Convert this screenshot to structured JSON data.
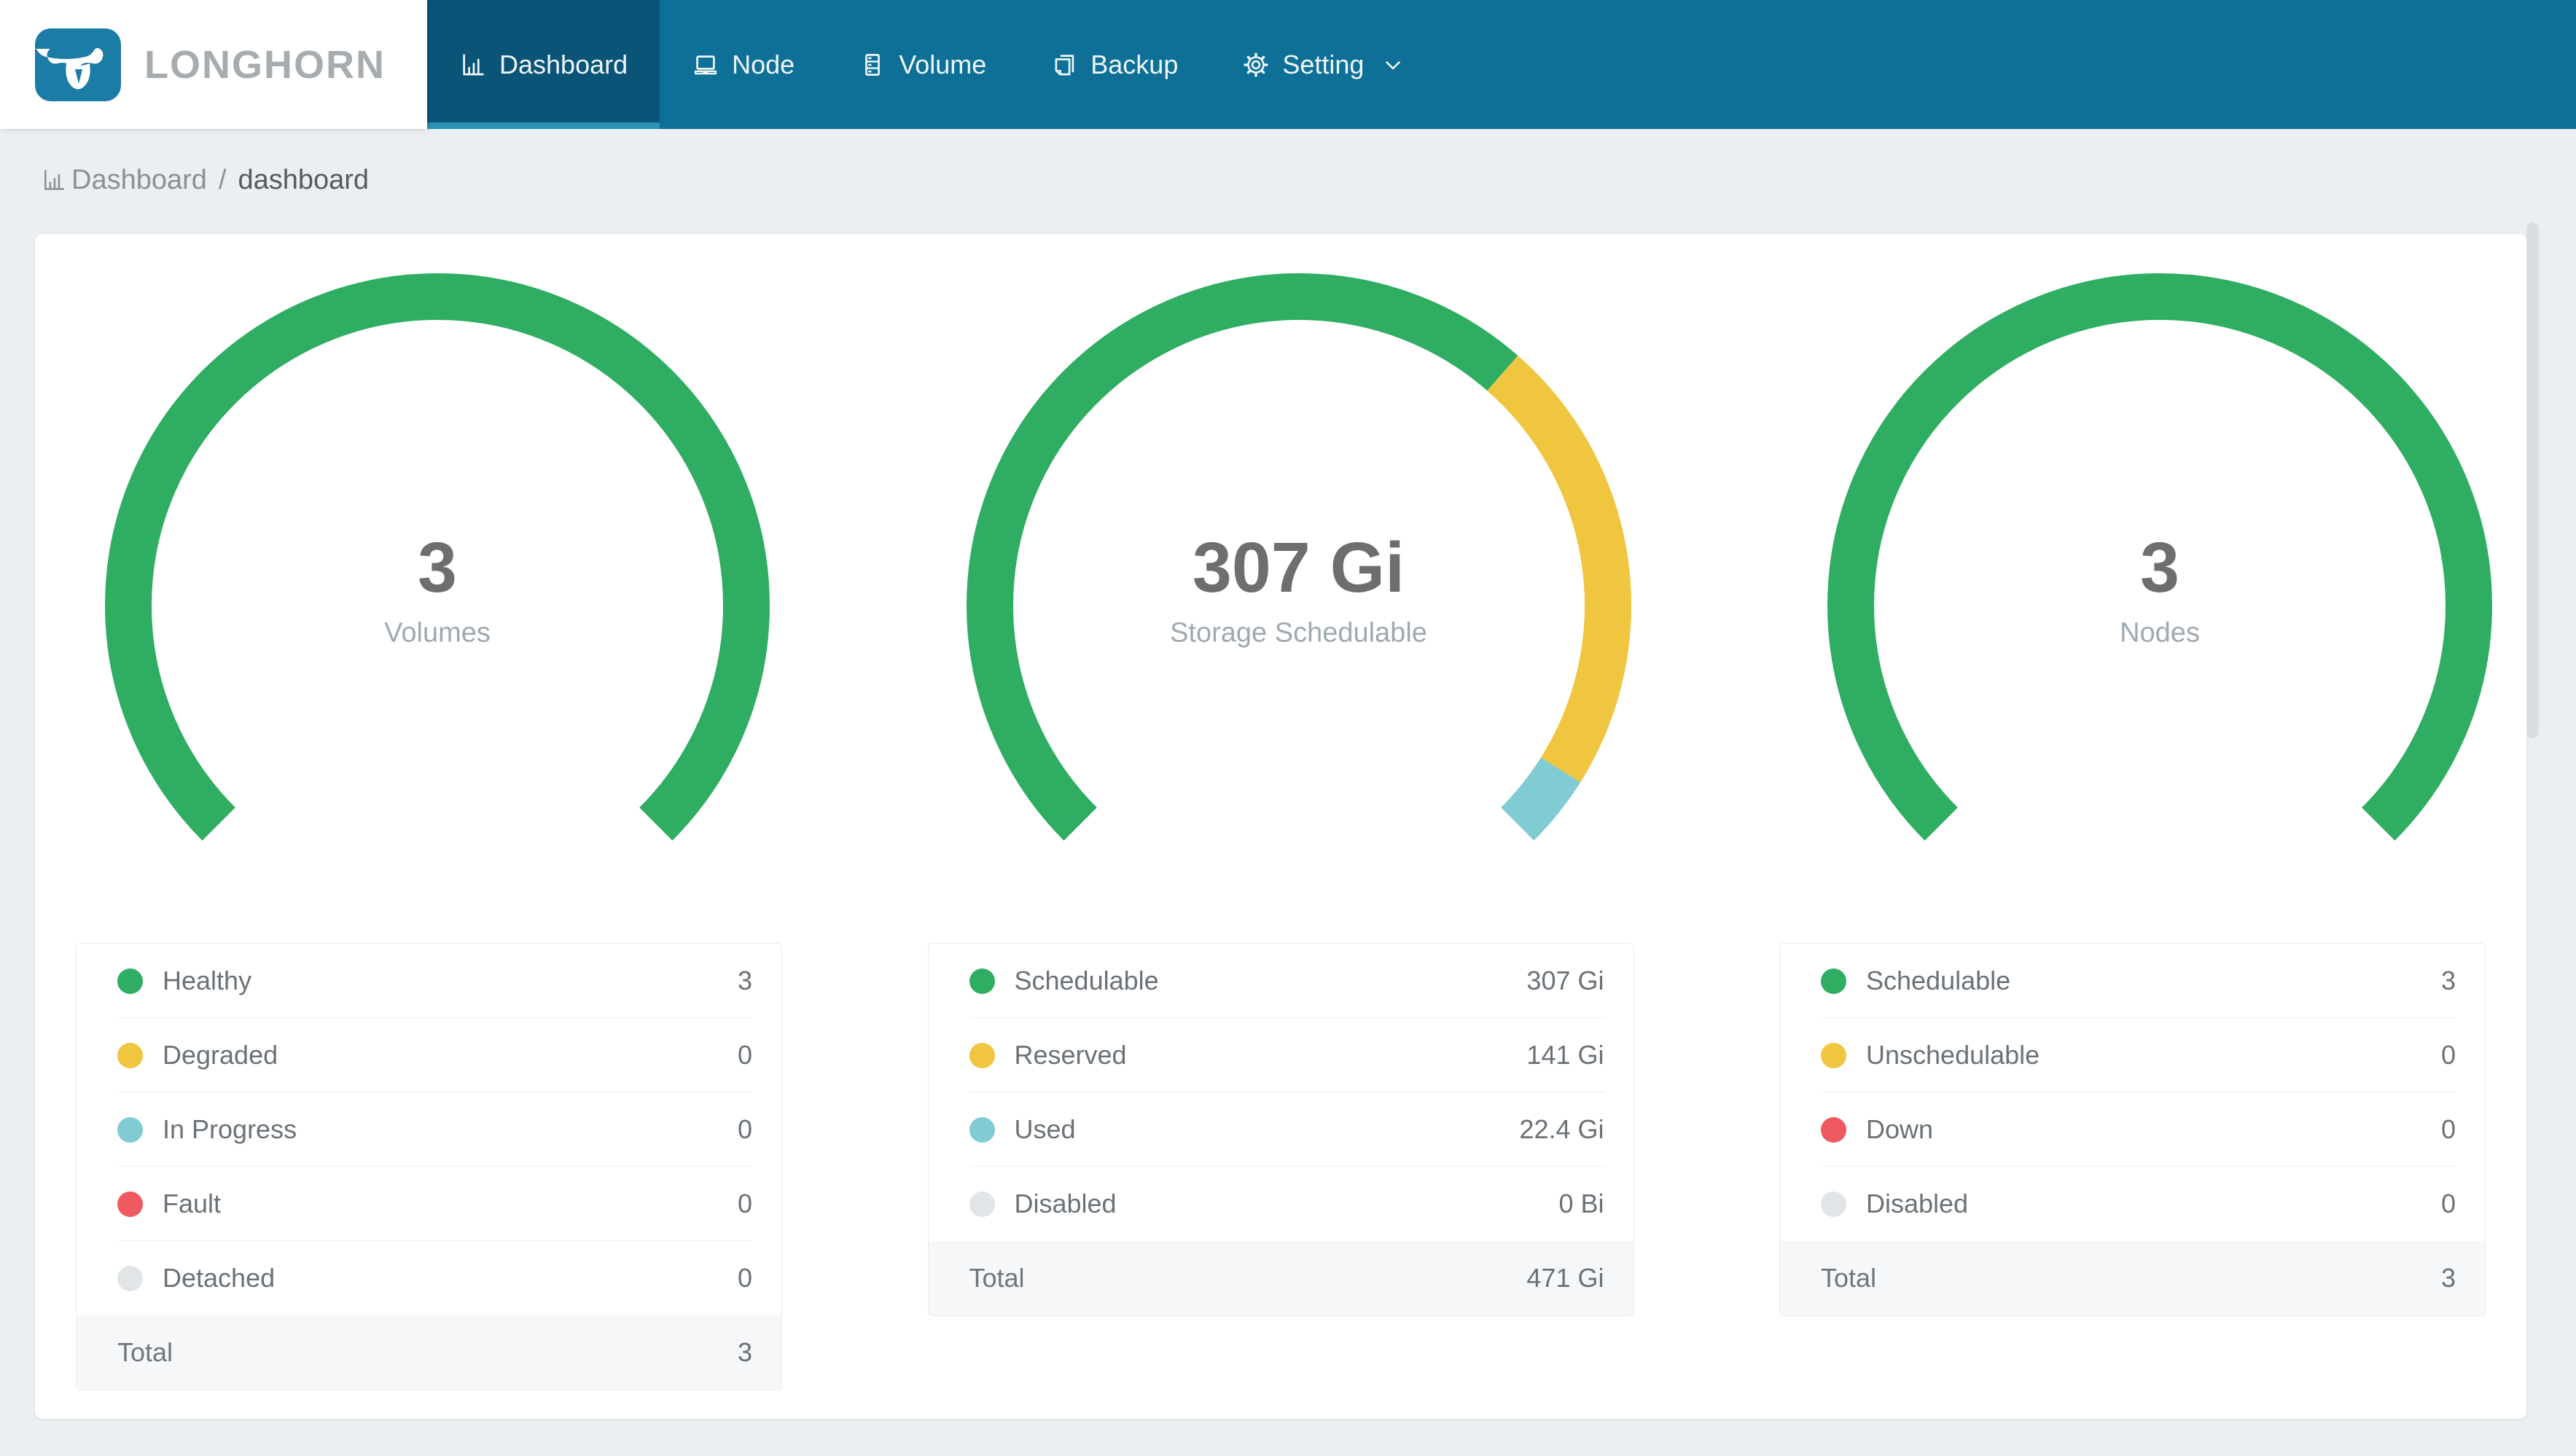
{
  "brand": {
    "name": "LONGHORN"
  },
  "theme": {
    "navbar_bg": "#0E7096",
    "navbar_active_bg": "#0A5478",
    "navbar_active_underline": "#2A93B6",
    "logo_blue": "#1B7CA6",
    "page_bg": "#ECEFF1",
    "green": "#2FAD62",
    "yellow": "#F0C53F",
    "teal": "#80CCD2",
    "red": "#EE5A5F",
    "gray": "#E2E5E7"
  },
  "navbar": {
    "items": [
      {
        "label": "Dashboard",
        "icon": "bar-chart-icon",
        "active": true
      },
      {
        "label": "Node",
        "icon": "laptop-icon",
        "active": false
      },
      {
        "label": "Volume",
        "icon": "volume-stack-icon",
        "active": false
      },
      {
        "label": "Backup",
        "icon": "copy-icon",
        "active": false
      },
      {
        "label": "Setting",
        "icon": "gear-icon",
        "active": false,
        "has_chevron": true
      }
    ]
  },
  "breadcrumb": {
    "section": "Dashboard",
    "separator": "/",
    "page": "dashboard"
  },
  "chart_data": [
    {
      "type": "gauge-donut",
      "title": "Volumes",
      "center_value": "3",
      "center_label": "Volumes",
      "start_deg": 225,
      "sweep_deg": 270,
      "total_label": "Total",
      "total_value": "3",
      "segments": [
        {
          "label": "Healthy",
          "value": 3,
          "display": "3",
          "color": "#2FAD62"
        },
        {
          "label": "Degraded",
          "value": 0,
          "display": "0",
          "color": "#F0C53F"
        },
        {
          "label": "In Progress",
          "value": 0,
          "display": "0",
          "color": "#80CCD2"
        },
        {
          "label": "Fault",
          "value": 0,
          "display": "0",
          "color": "#EE5A5F"
        },
        {
          "label": "Detached",
          "value": 0,
          "display": "0",
          "color": "#E2E5E7"
        }
      ]
    },
    {
      "type": "gauge-donut",
      "title": "Storage Schedulable",
      "center_value": "307 Gi",
      "center_label": "Storage Schedulable",
      "start_deg": 225,
      "sweep_deg": 270,
      "total_label": "Total",
      "total_value": "471 Gi",
      "segments": [
        {
          "label": "Schedulable",
          "value": 307,
          "display": "307 Gi",
          "color": "#2FAD62"
        },
        {
          "label": "Reserved",
          "value": 141,
          "display": "141 Gi",
          "color": "#F0C53F"
        },
        {
          "label": "Used",
          "value": 22.4,
          "display": "22.4 Gi",
          "color": "#80CCD2"
        },
        {
          "label": "Disabled",
          "value": 0,
          "display": "0 Bi",
          "color": "#E2E5E7"
        }
      ]
    },
    {
      "type": "gauge-donut",
      "title": "Nodes",
      "center_value": "3",
      "center_label": "Nodes",
      "start_deg": 225,
      "sweep_deg": 270,
      "total_label": "Total",
      "total_value": "3",
      "segments": [
        {
          "label": "Schedulable",
          "value": 3,
          "display": "3",
          "color": "#2FAD62"
        },
        {
          "label": "Unschedulable",
          "value": 0,
          "display": "0",
          "color": "#F0C53F"
        },
        {
          "label": "Down",
          "value": 0,
          "display": "0",
          "color": "#EE5A5F"
        },
        {
          "label": "Disabled",
          "value": 0,
          "display": "0",
          "color": "#E2E5E7"
        }
      ]
    }
  ]
}
